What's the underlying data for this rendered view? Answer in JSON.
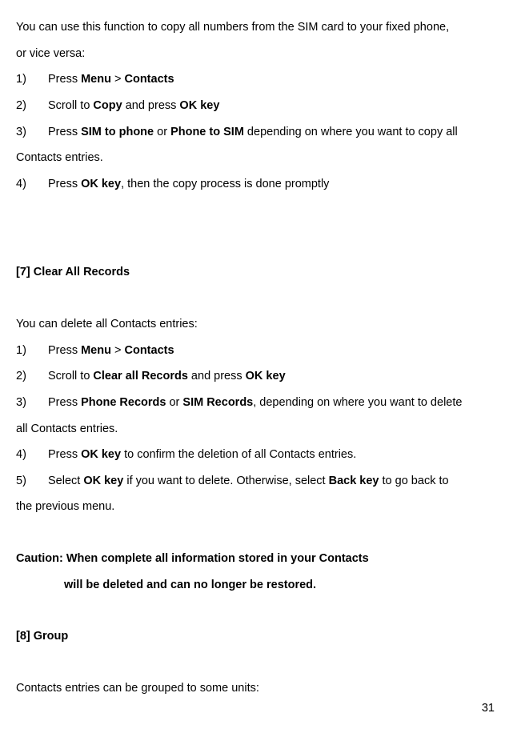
{
  "intro1": "You can use this function to copy all numbers from the SIM card to your fixed phone,",
  "intro2": "or vice versa:",
  "s1_li1_num": "1)",
  "s1_li1_a": "Press ",
  "s1_li1_b": "Menu",
  "s1_li1_c": " > ",
  "s1_li1_d": "Contacts",
  "s1_li2_num": "2)",
  "s1_li2_a": "Scroll to ",
  "s1_li2_b": "Copy ",
  "s1_li2_c": "and press ",
  "s1_li2_d": "OK key",
  "s1_li3_num": "3)",
  "s1_li3_a": "Press ",
  "s1_li3_b": "SIM to phone",
  "s1_li3_c": " or ",
  "s1_li3_d": "Phone to SIM",
  "s1_li3_e": " depending on where you want to copy all",
  "s1_li3_cont": "Contacts entries.",
  "s1_li4_num": "4)",
  "s1_li4_a": "Press ",
  "s1_li4_b": "OK key",
  "s1_li4_c": ", then the copy process is done promptly",
  "section7_heading": "[7]    Clear All Records",
  "s7_intro": "You can delete all Contacts entries:",
  "s7_li1_num": "1)",
  "s7_li1_a": "Press ",
  "s7_li1_b": "Menu",
  "s7_li1_c": " > ",
  "s7_li1_d": "Contacts",
  "s7_li2_num": "2)",
  "s7_li2_a": "Scroll to ",
  "s7_li2_b": "Clear all Records",
  "s7_li2_c": " and press ",
  "s7_li2_d": "OK key",
  "s7_li3_num": "3)",
  "s7_li3_a": "Press ",
  "s7_li3_b": "Phone Records",
  "s7_li3_c": " or ",
  "s7_li3_d": "SIM Records",
  "s7_li3_e": ", depending on where you want to delete",
  "s7_li3_cont": "all Contacts entries.",
  "s7_li4_num": "4)",
  "s7_li4_a": "Press ",
  "s7_li4_b": "OK key",
  "s7_li4_c": " to confirm the deletion of all Contacts entries.",
  "s7_li5_num": "5)",
  "s7_li5_a": "Select ",
  "s7_li5_b": "OK key ",
  "s7_li5_c": "if you want to delete. Otherwise, select ",
  "s7_li5_d": "Back key ",
  "s7_li5_e": "to go back to",
  "s7_li5_cont": "the previous menu.",
  "caution1": "Caution: When complete all information stored in your Contacts",
  "caution2": "will be deleted and can no longer be restored.",
  "section8_heading": "[8]    Group",
  "s8_intro": "Contacts entries can be grouped to some units:",
  "page_num": "31"
}
